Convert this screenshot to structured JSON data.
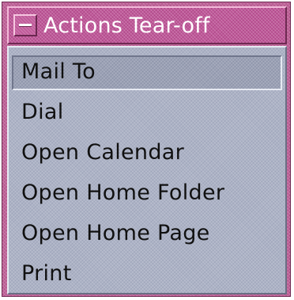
{
  "window": {
    "title": "Actions Tear-off",
    "menu_icon": "window-menu-icon"
  },
  "menu": {
    "items": [
      {
        "label": "Mail To",
        "selected": true
      },
      {
        "label": "Dial",
        "selected": false
      },
      {
        "label": "Open Calendar",
        "selected": false
      },
      {
        "label": "Open Home Folder",
        "selected": false
      },
      {
        "label": "Open Home Page",
        "selected": false
      },
      {
        "label": "Print",
        "selected": false
      }
    ]
  },
  "colors": {
    "title_bar": "#c0589a",
    "frame": "#c0649a",
    "menu_background": "#adb3c6",
    "selected_item": "#9ca2b6",
    "title_text": "#ffffff",
    "item_text": "#111111"
  }
}
